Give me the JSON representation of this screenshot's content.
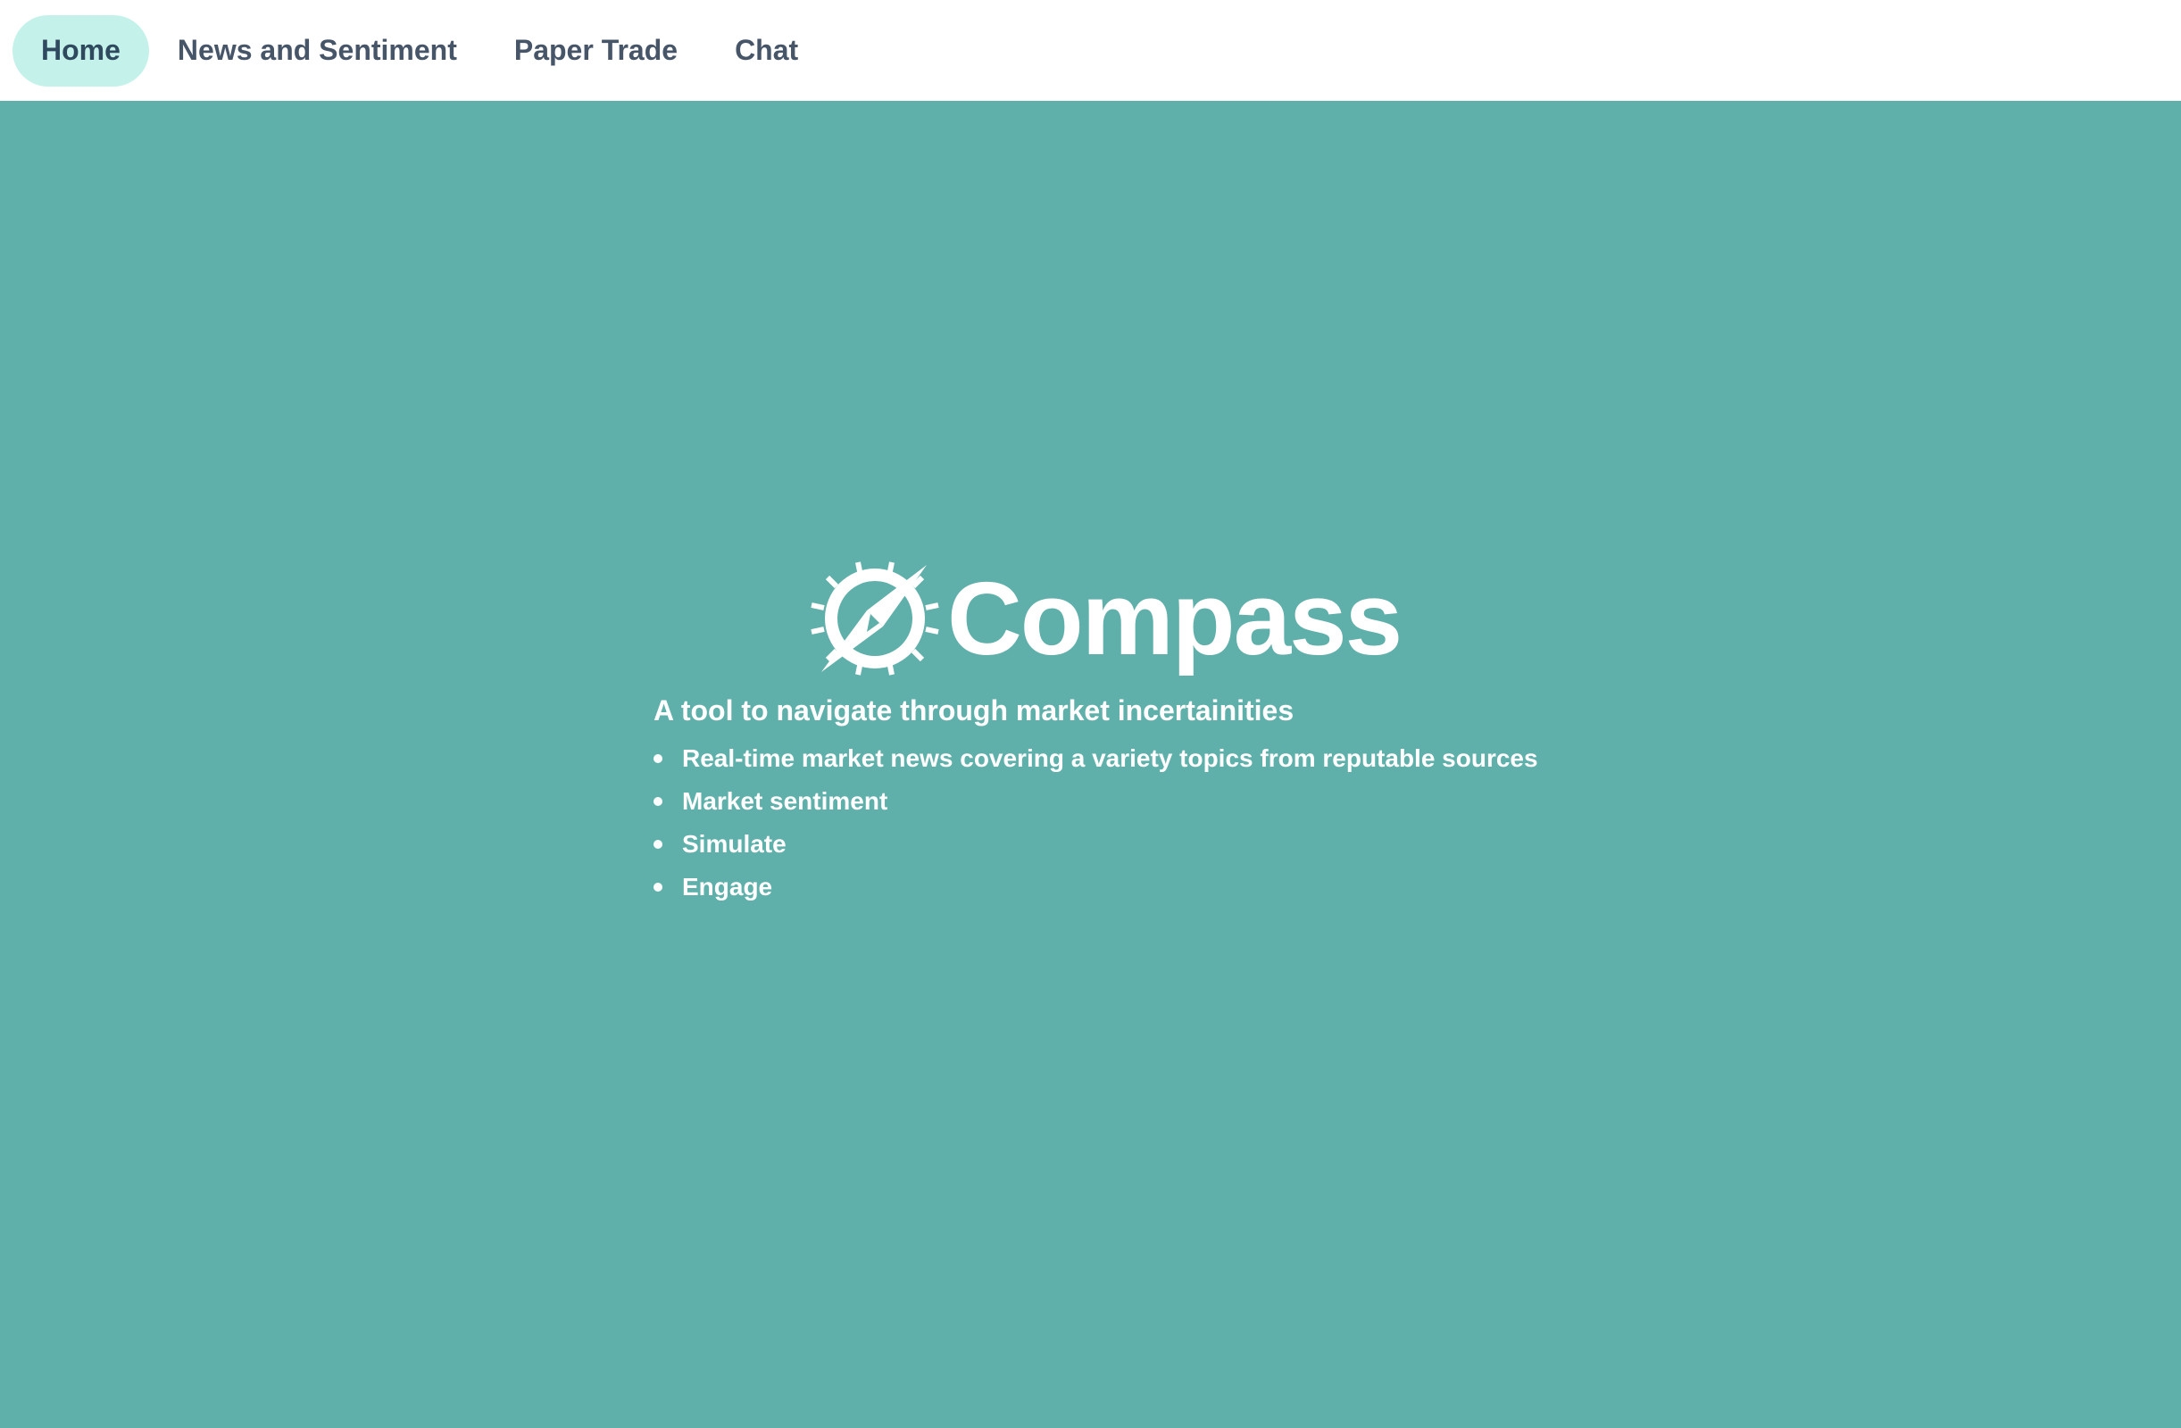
{
  "nav": {
    "items": [
      {
        "label": "Home",
        "active": true
      },
      {
        "label": "News and Sentiment",
        "active": false
      },
      {
        "label": "Paper Trade",
        "active": false
      },
      {
        "label": "Chat",
        "active": false
      }
    ]
  },
  "hero": {
    "logo_icon": "compass-icon",
    "title": "Compass",
    "tagline": "A tool to navigate through market incertainities",
    "features": [
      "Real-time market news covering a variety topics from reputable sources",
      "Market sentiment",
      "Simulate",
      "Engage"
    ]
  },
  "colors": {
    "hero_background": "#5fb0aa",
    "nav_active_background": "#c4f2ea",
    "nav_text": "#475569",
    "hero_text": "#ffffff"
  }
}
